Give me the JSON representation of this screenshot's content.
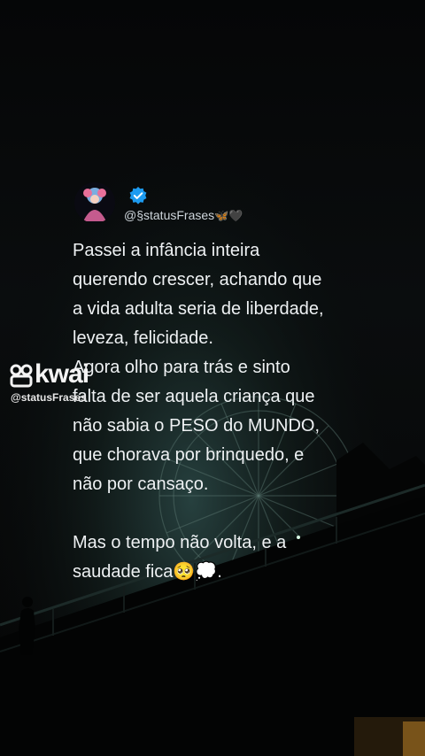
{
  "post": {
    "handle": "@§statusFrases",
    "handle_emoji_butterfly": "🦋",
    "handle_emoji_heart": "🖤",
    "text_lines": [
      "Passei a infância inteira",
      "querendo crescer, achando que",
      "a vida adulta seria de liberdade,",
      "leveza, felicidade.",
      "Agora olho para trás e sinto",
      "falta de ser aquela criança que",
      "não sabia o PESO do MUNDO,",
      "que chorava por brinquedo, e",
      "não por cansaço."
    ],
    "closing_line_1": "Mas o tempo não volta, e a",
    "closing_line_2_text": "saudade fica",
    "closing_line_2_emojis": "🥺💭",
    "closing_line_2_end": "."
  },
  "watermark": {
    "brand": "kwai",
    "handle": "@statusFrases"
  },
  "colors": {
    "verified_badge": "#1d9bf0",
    "text": "#eef1f3",
    "background": "#07090a"
  },
  "icons": {
    "verified": "verified-badge-icon",
    "watermark": "kwai-logo-icon"
  }
}
